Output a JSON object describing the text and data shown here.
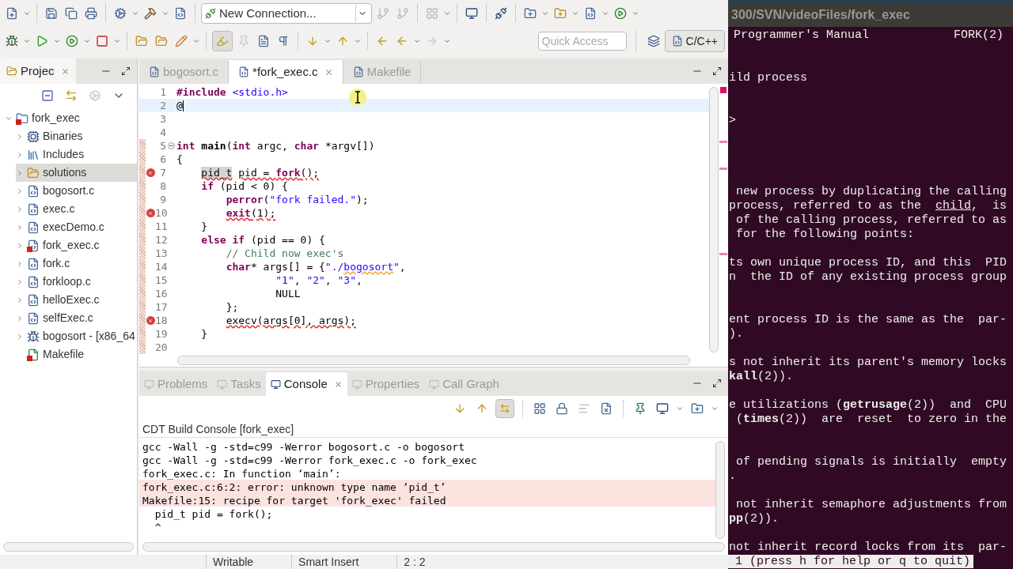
{
  "toolbar": {
    "connection": "New Connection...",
    "quick_access": {
      "placeholder": "Quick Access"
    },
    "perspective": "C/C++"
  },
  "project_explorer": {
    "title": "Projec",
    "tree": [
      {
        "label": "fork_exec",
        "kind": "project",
        "error": true,
        "expanded": true,
        "selected": false,
        "children": [
          {
            "label": "Binaries",
            "kind": "binaries",
            "error": false,
            "expanded": false,
            "selected": false
          },
          {
            "label": "Includes",
            "kind": "includes",
            "error": false,
            "expanded": false,
            "selected": false
          },
          {
            "label": "solutions",
            "kind": "folder",
            "error": false,
            "expanded": false,
            "selected": true
          },
          {
            "label": "bogosort.c",
            "kind": "source",
            "error": false,
            "expanded": false,
            "selected": false
          },
          {
            "label": "exec.c",
            "kind": "source",
            "error": false,
            "expanded": false,
            "selected": false
          },
          {
            "label": "execDemo.c",
            "kind": "source",
            "error": false,
            "expanded": false,
            "selected": false
          },
          {
            "label": "fork_exec.c",
            "kind": "source",
            "error": true,
            "expanded": false,
            "selected": false
          },
          {
            "label": "fork.c",
            "kind": "source",
            "error": false,
            "expanded": false,
            "selected": false
          },
          {
            "label": "forkloop.c",
            "kind": "source",
            "error": false,
            "expanded": false,
            "selected": false
          },
          {
            "label": "helloExec.c",
            "kind": "source",
            "error": false,
            "expanded": false,
            "selected": false
          },
          {
            "label": "selfExec.c",
            "kind": "source",
            "error": false,
            "expanded": false,
            "selected": false
          },
          {
            "label": "bogosort - [x86_64",
            "kind": "binary",
            "error": false,
            "expanded": false,
            "selected": false
          },
          {
            "label": "Makefile",
            "kind": "makefile",
            "error": true,
            "selected": false
          }
        ]
      }
    ]
  },
  "editor": {
    "tabs": [
      {
        "label": "bogosort.c",
        "selected": false
      },
      {
        "label": "*fork_exec.c",
        "selected": true
      },
      {
        "label": "Makefile",
        "selected": false
      }
    ],
    "lines": [
      {
        "number": "1",
        "current": false,
        "kind": "plain",
        "tokens": [
          {
            "t": "#include",
            "kind": "keyword",
            "error": false
          },
          {
            "t": " <stdio.h>",
            "kind": "string",
            "error": false
          }
        ]
      },
      {
        "number": "2",
        "current": true,
        "kind": "plain",
        "tokens": [
          {
            "t": "@",
            "kind": "plain",
            "error": false
          }
        ]
      },
      {
        "number": "3",
        "current": false,
        "kind": "plain"
      },
      {
        "number": "4",
        "current": false,
        "kind": "plain"
      },
      {
        "number": "5",
        "current": false,
        "kind": "fold",
        "tokens": [
          {
            "t": "int",
            "kind": "keyword",
            "error": false
          },
          {
            "t": " main",
            "kind": "function",
            "error": false
          },
          {
            "t": "(",
            "kind": "plain",
            "error": false
          },
          {
            "t": "int",
            "kind": "keyword",
            "error": false
          },
          {
            "t": " argc, ",
            "kind": "plain",
            "error": false
          },
          {
            "t": "char",
            "kind": "keyword",
            "error": false
          },
          {
            "t": " *argv[])",
            "kind": "plain",
            "error": false
          }
        ]
      },
      {
        "number": "6",
        "current": false,
        "kind": "plain",
        "tokens": [
          {
            "t": "{",
            "kind": "plain",
            "error": false
          }
        ]
      },
      {
        "number": "7",
        "current": false,
        "kind": "error",
        "tokens": [
          {
            "t": "    pid_t",
            "kind": "occurrence",
            "error": true
          },
          {
            "t": " pid = ",
            "kind": "plain",
            "error": true
          },
          {
            "t": "fork",
            "kind": "keyword",
            "error": true
          },
          {
            "t": "();",
            "kind": "plain",
            "error": true
          }
        ]
      },
      {
        "number": "8",
        "current": false,
        "kind": "plain",
        "tokens": [
          {
            "t": "    if",
            "kind": "keyword",
            "error": false
          },
          {
            "t": " (pid < 0) {",
            "kind": "plain",
            "error": false
          }
        ]
      },
      {
        "number": "9",
        "current": false,
        "kind": "plain",
        "tokens": [
          {
            "t": "        perror",
            "kind": "keyword",
            "error": false
          },
          {
            "t": "(",
            "kind": "plain",
            "error": false
          },
          {
            "t": "\"fork failed.\"",
            "kind": "string",
            "error": false
          },
          {
            "t": ");",
            "kind": "plain",
            "error": false
          }
        ]
      },
      {
        "number": "10",
        "current": false,
        "kind": "error",
        "tokens": [
          {
            "t": "        exit",
            "kind": "keyword",
            "error": true
          },
          {
            "t": "(1);",
            "kind": "plain",
            "error": true
          }
        ]
      },
      {
        "number": "11",
        "current": false,
        "kind": "plain",
        "tokens": [
          {
            "t": "    }",
            "kind": "plain",
            "error": false
          }
        ]
      },
      {
        "number": "12",
        "current": false,
        "kind": "plain",
        "tokens": [
          {
            "t": "    else if",
            "kind": "keyword",
            "error": false
          },
          {
            "t": " (pid == 0) {",
            "kind": "plain",
            "error": false
          }
        ]
      },
      {
        "number": "13",
        "current": false,
        "kind": "plain",
        "tokens": [
          {
            "t": "        // Child now exec's",
            "kind": "comment",
            "error": false
          }
        ]
      },
      {
        "number": "14",
        "current": false,
        "kind": "plain",
        "tokens": [
          {
            "t": "        char",
            "kind": "keyword",
            "error": false
          },
          {
            "t": "* args[] = {",
            "kind": "plain",
            "error": false
          },
          {
            "t": "\"./",
            "kind": "string",
            "error": false
          },
          {
            "t": "bogosort",
            "kind": "misspelled",
            "error": false
          },
          {
            "t": "\"",
            "kind": "string",
            "error": false
          },
          {
            "t": ",",
            "kind": "plain",
            "error": false
          }
        ]
      },
      {
        "number": "15",
        "current": false,
        "kind": "plain",
        "tokens": [
          {
            "t": "                \"1\"",
            "kind": "string",
            "error": false
          },
          {
            "t": ", ",
            "kind": "plain",
            "error": false
          },
          {
            "t": "\"2\"",
            "kind": "string",
            "error": false
          },
          {
            "t": ", ",
            "kind": "plain",
            "error": false
          },
          {
            "t": "\"3\"",
            "kind": "string",
            "error": false
          },
          {
            "t": ",",
            "kind": "plain",
            "error": false
          }
        ]
      },
      {
        "number": "16",
        "current": false,
        "kind": "plain",
        "tokens": [
          {
            "t": "                NULL",
            "kind": "plain",
            "error": false
          }
        ]
      },
      {
        "number": "17",
        "current": false,
        "kind": "plain",
        "tokens": [
          {
            "t": "        };",
            "kind": "plain",
            "error": false
          }
        ]
      },
      {
        "number": "18",
        "current": false,
        "kind": "error",
        "tokens": [
          {
            "t": "        execv(args[0], args);",
            "kind": "plain",
            "error": true
          }
        ]
      },
      {
        "number": "19",
        "current": false,
        "kind": "plain",
        "tokens": [
          {
            "t": "    }",
            "kind": "plain",
            "error": false
          }
        ]
      },
      {
        "number": "20",
        "current": false,
        "kind": "plain"
      }
    ]
  },
  "console": {
    "tabs": [
      {
        "label": "Problems",
        "selected": false
      },
      {
        "label": "Tasks",
        "selected": false
      },
      {
        "label": "Console",
        "selected": true
      },
      {
        "label": "Properties",
        "selected": false
      },
      {
        "label": "Call Graph",
        "selected": false
      }
    ],
    "title": "CDT Build Console [fork_exec]",
    "lines": [
      {
        "text": "gcc -Wall -g -std=c99 -Werror bogosort.c -o bogosort",
        "error": false
      },
      {
        "text": "gcc -Wall -g -std=c99 -Werror fork_exec.c -o fork_exec",
        "error": false
      },
      {
        "text": "fork_exec.c: In function ‘main’:",
        "error": false
      },
      {
        "text": "fork_exec.c:6:2: error: unknown type name ‘pid_t’",
        "error": true
      },
      {
        "text": "Makefile:15: recipe for target 'fork_exec' failed",
        "error": true
      },
      {
        "text": "  pid_t pid = fork();",
        "error": false
      },
      {
        "text": "  ^",
        "error": false
      }
    ]
  },
  "status_bar": [
    "Writable",
    "Smart Insert",
    "2 : 2"
  ],
  "terminal": {
    "title": "300/SVN/videoFiles/fork_exec",
    "lines": [
      {
        "kind": "header",
        "left": "Programmer's Manual",
        "right": "FORK(2)"
      },
      {
        "kind": "blank"
      },
      {
        "kind": "blank"
      },
      {
        "kind": "text",
        "text": "ild process"
      },
      {
        "kind": "blank"
      },
      {
        "kind": "blank"
      },
      {
        "kind": "text",
        "text": ">"
      },
      {
        "kind": "blank"
      },
      {
        "kind": "blank"
      },
      {
        "kind": "blank"
      },
      {
        "kind": "blank"
      },
      {
        "kind": "text",
        "text": " new process by duplicating the calling"
      },
      {
        "kind": "parts",
        "parts": [
          {
            "text": "process, referred to as the  ",
            "underline": false
          },
          {
            "text": "child",
            "underline": true
          },
          {
            "text": ",  is",
            "underline": false
          }
        ]
      },
      {
        "kind": "text",
        "text": " of the calling process, referred to as"
      },
      {
        "kind": "text",
        "text": " for the following points:"
      },
      {
        "kind": "blank"
      },
      {
        "kind": "text",
        "text": "ts own unique process ID, and this  PID"
      },
      {
        "kind": "text",
        "text": "n  the ID of any existing process group"
      },
      {
        "kind": "blank"
      },
      {
        "kind": "blank"
      },
      {
        "kind": "text",
        "text": "ent process ID is the same as the  par-"
      },
      {
        "kind": "text",
        "text": ")."
      },
      {
        "kind": "blank"
      },
      {
        "kind": "text",
        "text": "s not inherit its parent's memory locks"
      },
      {
        "kind": "text",
        "text": "**kall**(2))."
      },
      {
        "kind": "blank"
      },
      {
        "kind": "text",
        "text": "e utilizations (**getrusage**(2))  and  CPU"
      },
      {
        "kind": "text",
        "text": " (**times**(2))  are  reset  to zero in the"
      },
      {
        "kind": "blank"
      },
      {
        "kind": "blank"
      },
      {
        "kind": "text",
        "text": " of pending signals is initially  empty"
      },
      {
        "kind": "text",
        "text": "."
      },
      {
        "kind": "blank"
      },
      {
        "kind": "text",
        "text": " not inherit semaphore adjustments from"
      },
      {
        "kind": "text",
        "text": "**pp**(2))."
      },
      {
        "kind": "blank"
      },
      {
        "kind": "text",
        "text": "not inherit record locks from its  par-"
      },
      {
        "kind": "prompt",
        "text": " 1 (press h for help or q to quit)"
      }
    ]
  }
}
